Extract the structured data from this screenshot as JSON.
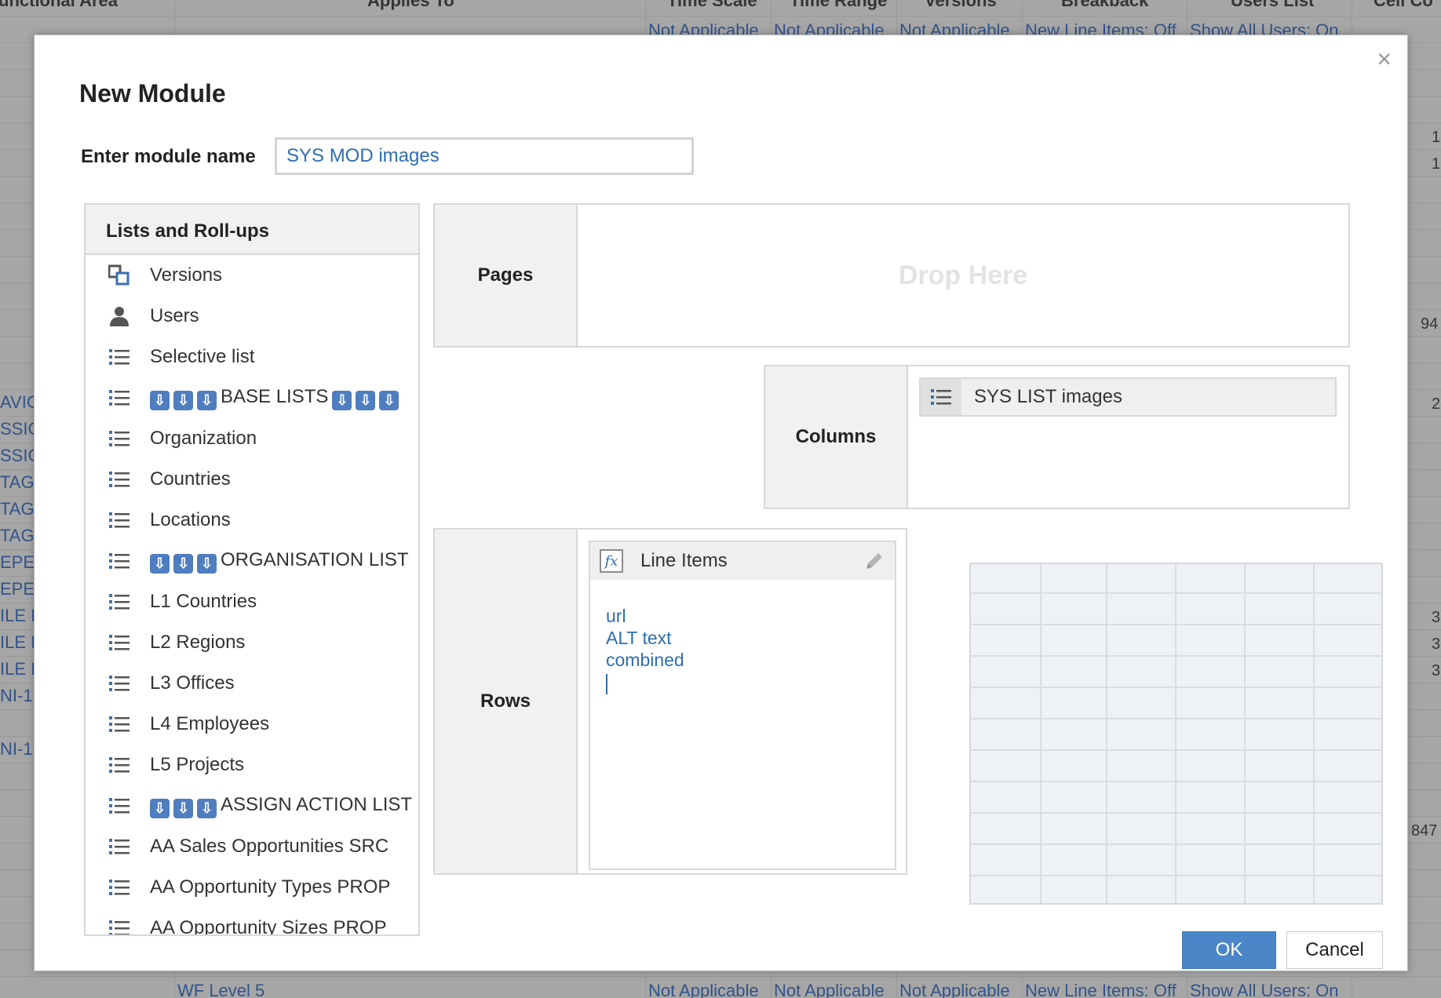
{
  "background": {
    "headers": [
      "unctional Area",
      "Applies To",
      "Time Scale",
      "Time Range",
      "Versions",
      "Breakback",
      "Users List",
      "Cell Co"
    ],
    "top_row": [
      "Not Applicable",
      "Not Applicable",
      "Not Applicable",
      "New Line Items: Off",
      "Show All Users: On"
    ],
    "bottom_row": [
      "WF Level 5",
      "Not Applicable",
      "Not Applicable",
      "Not Applicable",
      "New Line Items: Off",
      "Show All Users: On"
    ],
    "left_fragments": [
      "AVIC",
      "SSIC",
      "SSIC",
      "TAG",
      "TAG",
      "TAG",
      "EPE",
      "EPE",
      "ILE I",
      "ILE I",
      "ILE I",
      "NI-1(",
      "NI-1("
    ],
    "right_numbers": [
      "1",
      "1",
      "94",
      "2",
      "3",
      "3",
      "3",
      "847"
    ]
  },
  "dialog": {
    "title": "New Module",
    "close": "×",
    "name_label": "Enter module name",
    "name_value": "SYS MOD images",
    "lists_header": "Lists and Roll-ups",
    "lists": [
      {
        "icon": "versions-icon",
        "label": "Versions",
        "arrows": false
      },
      {
        "icon": "user-icon",
        "label": "Users",
        "arrows": false
      },
      {
        "icon": "list-icon",
        "label": "Selective list",
        "arrows": false
      },
      {
        "icon": "list-icon",
        "label": "BASE LISTS",
        "arrows": true,
        "trailing": true
      },
      {
        "icon": "list-icon",
        "label": "Organization",
        "arrows": false
      },
      {
        "icon": "list-icon",
        "label": "Countries",
        "arrows": false
      },
      {
        "icon": "list-icon",
        "label": "Locations",
        "arrows": false
      },
      {
        "icon": "list-icon",
        "label": "ORGANISATION LIST",
        "arrows": true,
        "trailing": false
      },
      {
        "icon": "list-icon",
        "label": "L1 Countries",
        "arrows": false
      },
      {
        "icon": "list-icon",
        "label": "L2 Regions",
        "arrows": false
      },
      {
        "icon": "list-icon",
        "label": "L3 Offices",
        "arrows": false
      },
      {
        "icon": "list-icon",
        "label": "L4 Employees",
        "arrows": false
      },
      {
        "icon": "list-icon",
        "label": "L5 Projects",
        "arrows": false
      },
      {
        "icon": "list-icon",
        "label": "ASSIGN ACTION LIST",
        "arrows": true,
        "trailing": false
      },
      {
        "icon": "list-icon",
        "label": "AA Sales Opportunities SRC",
        "arrows": false
      },
      {
        "icon": "list-icon",
        "label": "AA Opportunity Types PROP",
        "arrows": false
      },
      {
        "icon": "list-icon",
        "label": "AA Opportunity Sizes PROP",
        "arrows": false
      }
    ],
    "pages_label": "Pages",
    "drop_here": "Drop Here",
    "columns_label": "Columns",
    "columns_item": "SYS LIST images",
    "rows_label": "Rows",
    "line_items_title": "Line Items",
    "line_items": [
      "url",
      "ALT text",
      "combined"
    ],
    "ok_label": "OK",
    "cancel_label": "Cancel",
    "colors": {
      "accent": "#4a86c8",
      "link": "#2e6db4"
    }
  }
}
